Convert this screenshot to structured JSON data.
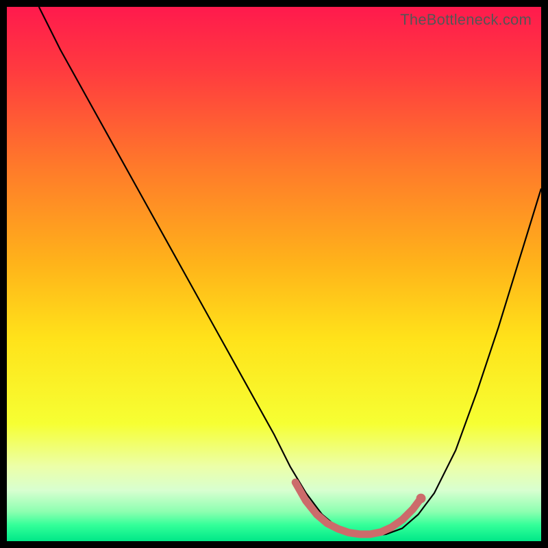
{
  "watermark": "TheBottleneck.com",
  "chart_data": {
    "type": "line",
    "title": "",
    "xlabel": "",
    "ylabel": "",
    "xlim": [
      0,
      100
    ],
    "ylim": [
      0,
      100
    ],
    "background_gradient": {
      "stops": [
        {
          "offset": 0.0,
          "color": "#ff1a4d"
        },
        {
          "offset": 0.12,
          "color": "#ff3b3f"
        },
        {
          "offset": 0.3,
          "color": "#ff7a2a"
        },
        {
          "offset": 0.48,
          "color": "#ffb31a"
        },
        {
          "offset": 0.62,
          "color": "#ffe21a"
        },
        {
          "offset": 0.78,
          "color": "#f6ff33"
        },
        {
          "offset": 0.86,
          "color": "#ecffa8"
        },
        {
          "offset": 0.905,
          "color": "#d8ffd0"
        },
        {
          "offset": 0.945,
          "color": "#8cffb0"
        },
        {
          "offset": 0.97,
          "color": "#33ff99"
        },
        {
          "offset": 1.0,
          "color": "#00e888"
        }
      ]
    },
    "series": [
      {
        "name": "bottleneck-curve",
        "color": "#000000",
        "width": 2.2,
        "x": [
          6,
          10,
          15,
          20,
          25,
          30,
          35,
          40,
          45,
          50,
          53,
          56,
          59,
          62,
          65,
          68,
          71,
          74,
          77,
          80,
          84,
          88,
          92,
          96,
          100
        ],
        "y": [
          100,
          92,
          83,
          74,
          65,
          56,
          47,
          38,
          29,
          20,
          14,
          9,
          5,
          2.5,
          1.2,
          1.0,
          1.3,
          2.4,
          5,
          9,
          17,
          28,
          40,
          53,
          66
        ]
      },
      {
        "name": "optimal-zone",
        "color": "#cc6b6b",
        "width": 11,
        "linecap": "round",
        "x": [
          54,
          56,
          58,
          60,
          62,
          64,
          66,
          68,
          70,
          72,
          74,
          76,
          77.5
        ],
        "y": [
          11,
          7.5,
          5,
          3.3,
          2.3,
          1.6,
          1.3,
          1.3,
          1.7,
          2.6,
          4,
          6,
          8
        ]
      }
    ],
    "markers": [
      {
        "name": "optimal-point",
        "x": 77.5,
        "y": 8,
        "r": 7,
        "color": "#cc6b6b"
      }
    ]
  }
}
